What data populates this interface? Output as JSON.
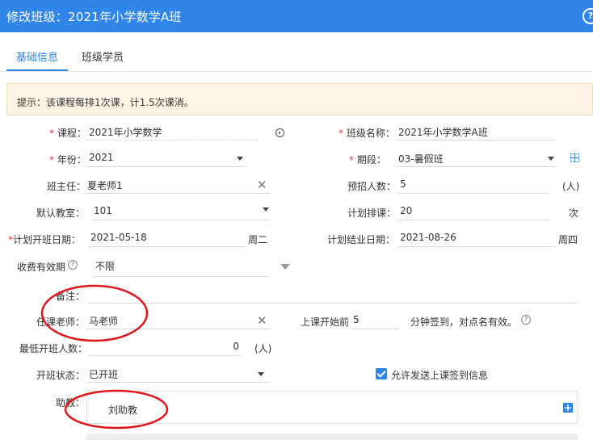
{
  "window": {
    "title": "修改班级：2021年小学数学A班",
    "help_label": "?"
  },
  "tabs": [
    {
      "label": "基础信息",
      "active": true
    },
    {
      "label": "班级学员",
      "active": false
    }
  ],
  "tip": "提示：该课程每排1次课，计1.5次课消。",
  "required_mark": "*",
  "form": {
    "course": {
      "label": "课程：",
      "value": "2021年小学数学"
    },
    "class_name": {
      "label": "班级名称：",
      "value": "2021年小学数学A班"
    },
    "year": {
      "label": "年份：",
      "value": "2021"
    },
    "term": {
      "label": "期段：",
      "value": "03-暑假班"
    },
    "head_teacher": {
      "label": "班主任：",
      "value": "夏老师1"
    },
    "enroll_count": {
      "label": "预招人数：",
      "value": "5",
      "suffix": "(人)"
    },
    "classroom": {
      "label": "默认教室：",
      "value": "101"
    },
    "planned_lessons": {
      "label": "计划排课：",
      "value": "20",
      "suffix": "次"
    },
    "start_date": {
      "label": "计划开班日期：",
      "value": "2021-05-18",
      "weekday": "周二"
    },
    "end_date": {
      "label": "计划结业日期：",
      "value": "2021-08-26",
      "weekday": "周四"
    },
    "fee_validity": {
      "label": "收费有效期",
      "value": "不限",
      "help": "?"
    },
    "remark": {
      "label": "备注：",
      "value": ""
    },
    "teacher": {
      "label": "任课老师：",
      "value": "马老师"
    },
    "checkin": {
      "label": "上课开始前",
      "value": "5",
      "suffix": "分钟签到，对点名有效。",
      "help": "?"
    },
    "min_students": {
      "label": "最低开班人数：",
      "value": "0",
      "suffix": "(人)"
    },
    "status": {
      "label": "开班状态：",
      "value": "已开班"
    },
    "send_checkin_msg": {
      "label": "允许发送上课签到信息",
      "checked": true
    },
    "assistant": {
      "label": "助教：",
      "value": "刘助教"
    }
  },
  "colors": {
    "primary": "#2f86e8",
    "annotation": "#e0161b",
    "required": "#e4393c"
  }
}
